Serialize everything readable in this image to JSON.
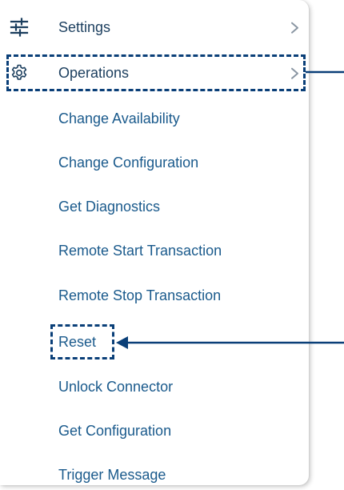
{
  "menu": {
    "settings": {
      "label": "Settings",
      "icon": "sliders-icon"
    },
    "operations": {
      "label": "Operations",
      "icon": "gear-icon"
    },
    "operations_items": [
      {
        "label": "Change Availability"
      },
      {
        "label": "Change Configuration"
      },
      {
        "label": "Get Diagnostics"
      },
      {
        "label": "Remote Start Transaction"
      },
      {
        "label": "Remote Stop Transaction"
      },
      {
        "label": "Reset"
      },
      {
        "label": "Unlock Connector"
      },
      {
        "label": "Get Configuration"
      },
      {
        "label": "Trigger Message"
      }
    ]
  },
  "colors": {
    "text": "#1b5a8a",
    "icon": "#1b3e5e",
    "highlight": "#0a3f78",
    "chevron": "#8a96a3"
  }
}
